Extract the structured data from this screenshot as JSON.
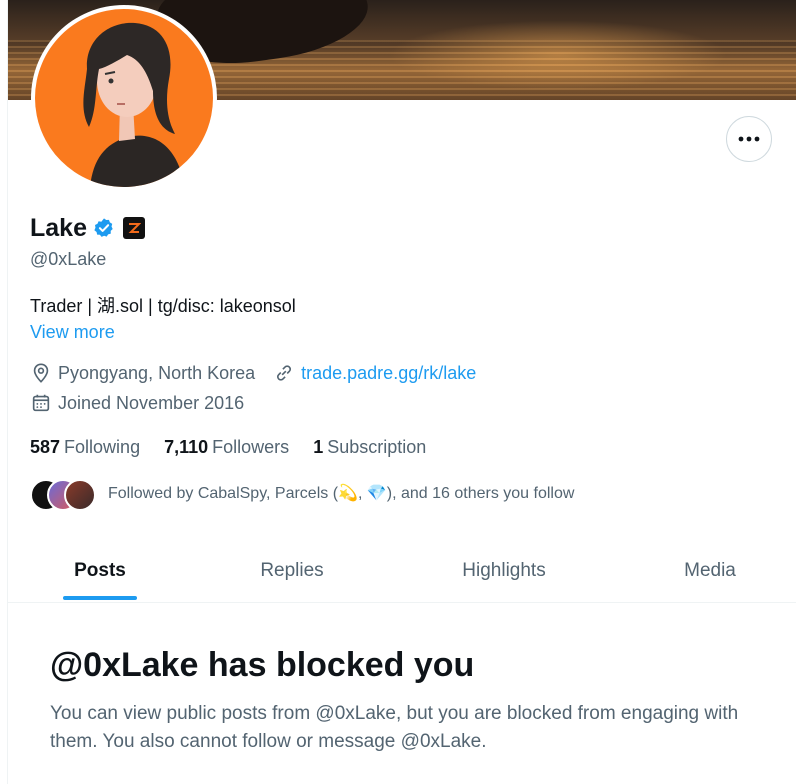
{
  "profile": {
    "display_name": "Lake",
    "handle": "@0xLake",
    "bio": "Trader | 湖.sol | tg/disc: lakeonsol",
    "view_more": "View more",
    "location": "Pyongyang, North Korea",
    "website": "trade.padre.gg/rk/lake",
    "joined": "Joined November 2016"
  },
  "stats": {
    "following_count": "587",
    "following_label": "Following",
    "followers_count": "7,110",
    "followers_label": "Followers",
    "subscriptions_count": "1",
    "subscriptions_label": "Subscription"
  },
  "followed_by": {
    "text": "Followed by CabalSpy, Parcels (💫, 💎), and 16 others you follow"
  },
  "tabs": [
    {
      "label": "Posts",
      "active": true
    },
    {
      "label": "Replies",
      "active": false
    },
    {
      "label": "Highlights",
      "active": false
    },
    {
      "label": "Media",
      "active": false
    }
  ],
  "blocked": {
    "title": "@0xLake has blocked you",
    "description": "You can view public posts from @0xLake, but you are blocked from engaging with them. You also cannot follow or message @0xLake."
  },
  "colors": {
    "accent": "#1d9bf0",
    "avatar_background": "#fa7a1e",
    "text_primary": "#0f1419",
    "text_secondary": "#536471"
  },
  "icons": [
    "more-icon",
    "verified-badge-icon",
    "affiliate-badge-icon",
    "location-icon",
    "link-icon",
    "calendar-icon"
  ]
}
